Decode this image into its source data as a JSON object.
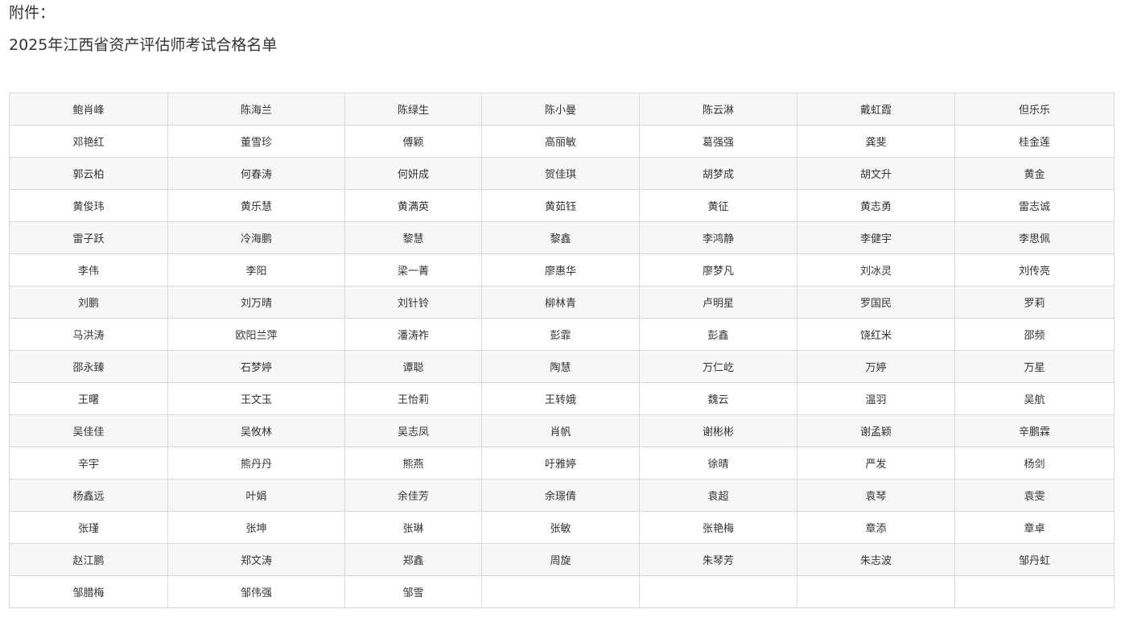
{
  "attachment_label": "附件：",
  "title": "2025年江西省资产评估师考试合格名单",
  "rows": [
    [
      "鲍肖峰",
      "陈海兰",
      "陈绿生",
      "陈小曼",
      "陈云淋",
      "戴虹霞",
      "但乐乐"
    ],
    [
      "邓艳红",
      "董雪珍",
      "傅颖",
      "高丽敏",
      "葛强强",
      "龚斐",
      "桂金莲"
    ],
    [
      "郭云柏",
      "何春涛",
      "何妍成",
      "贺佳琪",
      "胡梦成",
      "胡文升",
      "黄金"
    ],
    [
      "黄俊玮",
      "黄乐慧",
      "黄满英",
      "黄茹钰",
      "黄征",
      "黄志勇",
      "雷志诚"
    ],
    [
      "雷子跃",
      "冷海鹏",
      "黎慧",
      "黎鑫",
      "李鸿静",
      "李健宇",
      "李思佩"
    ],
    [
      "李伟",
      "李阳",
      "梁一菁",
      "廖惠华",
      "廖梦凡",
      "刘冰灵",
      "刘传亮"
    ],
    [
      "刘鹏",
      "刘万晴",
      "刘针铃",
      "柳林青",
      "卢明星",
      "罗国民",
      "罗莉"
    ],
    [
      "马洪涛",
      "欧阳兰萍",
      "潘涛祚",
      "彭霏",
      "彭鑫",
      "饶红米",
      "邵频"
    ],
    [
      "邵永臻",
      "石梦婷",
      "谭聪",
      "陶慧",
      "万仁屹",
      "万婷",
      "万星"
    ],
    [
      "王曙",
      "王文玉",
      "王怡莉",
      "王转娥",
      "魏云",
      "温羽",
      "吴航"
    ],
    [
      "吴佳佳",
      "吴攸林",
      "吴志凤",
      "肖帆",
      "谢彬彬",
      "谢孟颖",
      "辛鹏霖"
    ],
    [
      "辛宇",
      "熊丹丹",
      "熊燕",
      "吁雅婷",
      "徐晴",
      "严发",
      "杨剑"
    ],
    [
      "杨鑫远",
      "叶娟",
      "余佳芳",
      "余璟倩",
      "袁超",
      "袁琴",
      "袁雯"
    ],
    [
      "张瑾",
      "张坤",
      "张琳",
      "张敏",
      "张艳梅",
      "章添",
      "章卓"
    ],
    [
      "赵江鹏",
      "郑文涛",
      "郑鑫",
      "周旋",
      "朱琴芳",
      "朱志波",
      "邹丹虹"
    ],
    [
      "邹腊梅",
      "邹伟强",
      "邹雪",
      "",
      "",
      "",
      ""
    ]
  ]
}
